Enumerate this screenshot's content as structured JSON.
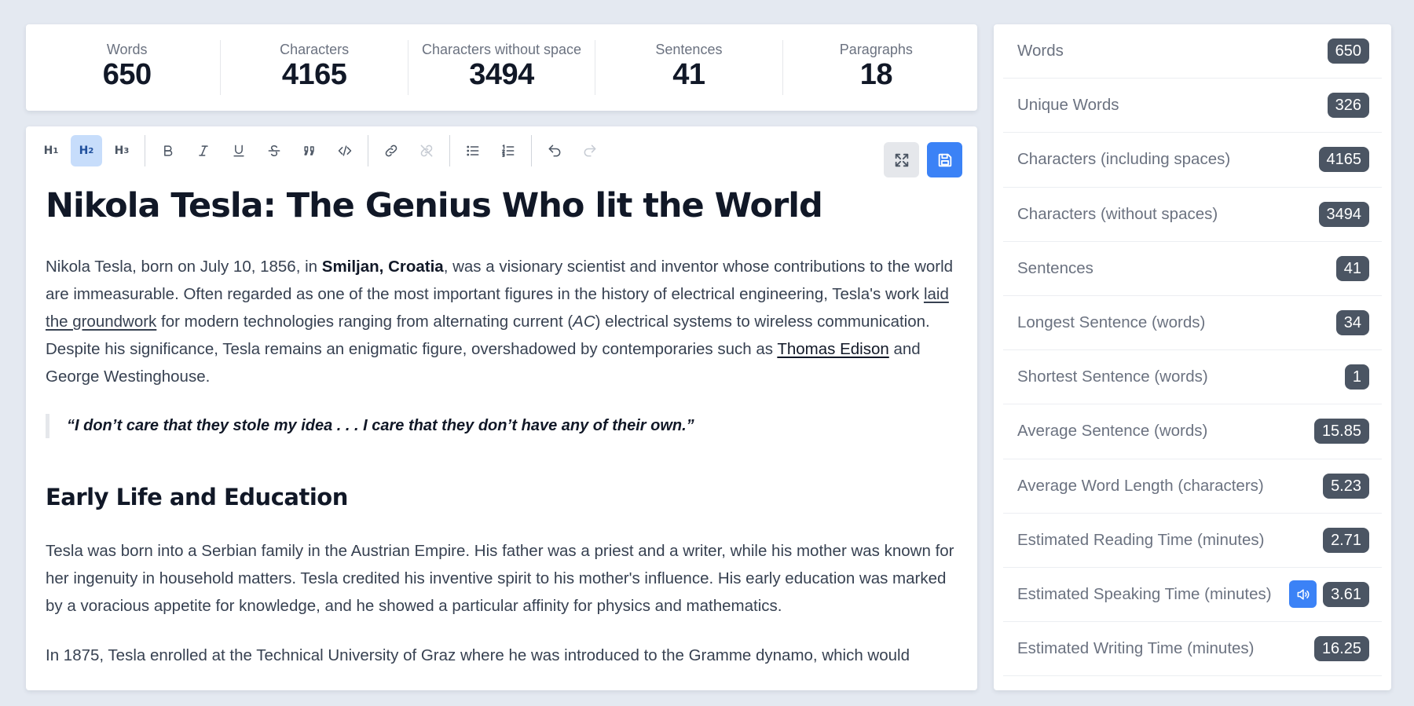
{
  "stats": [
    {
      "label": "Words",
      "value": "650"
    },
    {
      "label": "Characters",
      "value": "4165"
    },
    {
      "label": "Characters without space",
      "value": "3494"
    },
    {
      "label": "Sentences",
      "value": "41"
    },
    {
      "label": "Paragraphs",
      "value": "18"
    }
  ],
  "toolbar": {
    "h1_label": "H",
    "h1_sub": "1",
    "h2_label": "H",
    "h2_sub": "2",
    "h3_label": "H",
    "h3_sub": "3",
    "active_tool": "heading-2",
    "icons": [
      "bold-icon",
      "italic-icon",
      "underline-icon",
      "strikethrough-icon",
      "blockquote-icon",
      "code-icon",
      "link-icon",
      "unlink-icon",
      "bullet-list-icon",
      "ordered-list-icon",
      "undo-icon",
      "redo-icon",
      "expand-icon",
      "save-icon"
    ]
  },
  "document": {
    "title": "Nikola Tesla: The Genius Who lit the World",
    "p1": {
      "t1": "Nikola Tesla, born on July 10, 1856, in ",
      "b1": "Smiljan, Croatia",
      "t2": ", was a visionary scientist and inventor whose contributions to the world are immeasurable. Often regarded as one of the most important figures in the history of electrical engineering, Tesla's work ",
      "u1": "laid the groundwork",
      "t3": " for modern technologies ranging from alternating current (",
      "i1": "AC",
      "t4": ") electrical systems to wireless communication. Despite his significance, Tesla remains an enigmatic figure, overshadowed by contemporaries such as ",
      "l1": "Thomas Edison",
      "t5": " and George Westinghouse."
    },
    "quote": "“I don’t care that they stole my idea . . . I care that they don’t have any of their own.”",
    "h2": "Early Life and Education",
    "p2": "Tesla was born into a Serbian family in the Austrian Empire. His father was a priest and a writer, while his mother was known for her ingenuity in household matters. Tesla credited his inventive spirit to his mother's influence. His early education was marked by a voracious appetite for knowledge, and he showed a particular affinity for physics and mathematics.",
    "p3": "In 1875, Tesla enrolled at the Technical University of Graz where he was introduced to the Gramme dynamo, which would"
  },
  "side_stats": [
    {
      "label": "Words",
      "value": "650"
    },
    {
      "label": "Unique Words",
      "value": "326"
    },
    {
      "label": "Characters (including spaces)",
      "value": "4165"
    },
    {
      "label": "Characters (without spaces)",
      "value": "3494"
    },
    {
      "label": "Sentences",
      "value": "41"
    },
    {
      "label": "Longest Sentence (words)",
      "value": "34"
    },
    {
      "label": "Shortest Sentence (words)",
      "value": "1"
    },
    {
      "label": "Average Sentence (words)",
      "value": "15.85"
    },
    {
      "label": "Average Word Length (characters)",
      "value": "5.23"
    },
    {
      "label": "Estimated Reading Time (minutes)",
      "value": "2.71"
    },
    {
      "label": "Estimated Speaking Time (minutes)",
      "value": "3.61"
    },
    {
      "label": "Estimated Writing Time (minutes)",
      "value": "16.25"
    }
  ],
  "colors": {
    "background": "#e4e9f1",
    "accent": "#3b82f6",
    "active_tool_bg": "#c7ddfb",
    "badge": "#4b5563"
  }
}
